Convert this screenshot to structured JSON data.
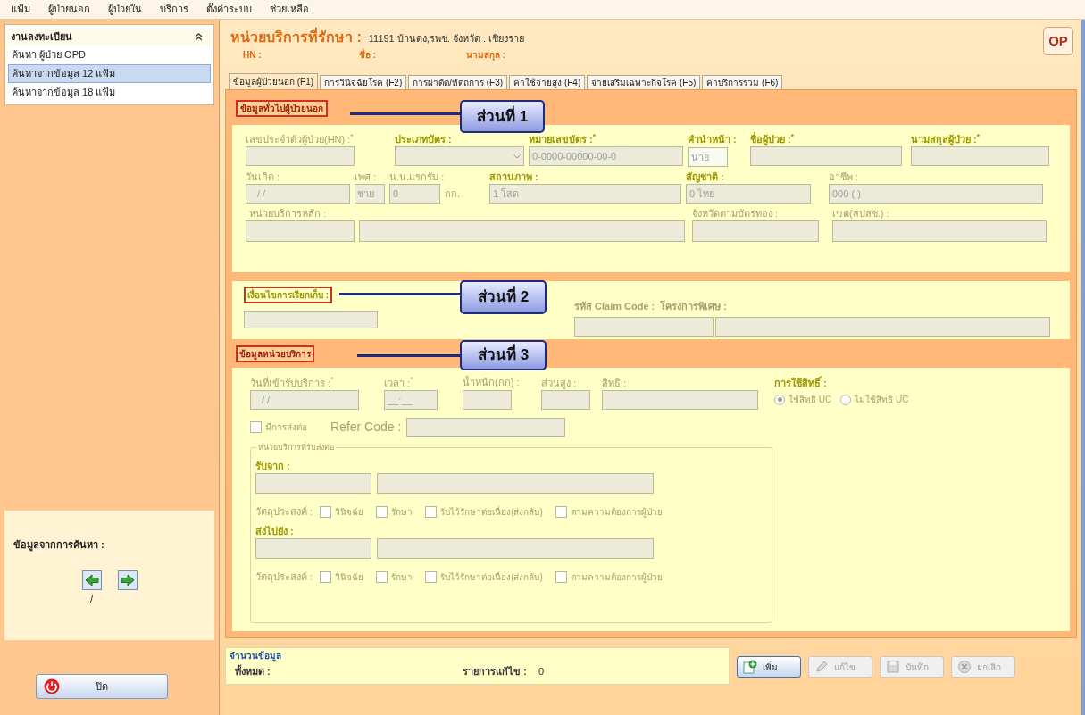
{
  "menu": [
    "แฟ้ม",
    "ผู้ป่วยนอก",
    "ผู้ป่วยใน",
    "บริการ",
    "ตั้งค่าระบบ",
    "ช่วยเหลือ"
  ],
  "sidebar": {
    "title": "งานลงทะเบียน",
    "items": [
      {
        "label": "ค้นหา ผู้ป่วย OPD",
        "selected": false
      },
      {
        "label": "ค้นหาจากข้อมูล 12 แฟ้ม",
        "selected": true
      },
      {
        "label": "ค้นหาจากข้อมูล 18 แฟ้ม",
        "selected": false
      }
    ],
    "search_result": {
      "label": "ข้อมูลจากการค้นหา :",
      "page": "/"
    },
    "close_button": "ปิด"
  },
  "header": {
    "title": "หน่วยบริการที่รักษา :",
    "unit": "11191 บ้านดง,รพช. จังหวัด : เชียงราย",
    "hn_label": "HN :",
    "name_label": "ชื่อ :",
    "surname_label": "นามสกุล :",
    "logo": "OP"
  },
  "tabs": [
    {
      "label": "ข้อมูลผู้ป่วยนอก (F1)",
      "selected": true
    },
    {
      "label": "การวินิจฉัยโรค (F2)",
      "selected": false
    },
    {
      "label": "การผ่าตัด/หัตถการ (F3)",
      "selected": false
    },
    {
      "label": "ค่าใช้จ่ายสูง (F4)",
      "selected": false
    },
    {
      "label": "จ่ายเสริมเฉพาะกิจโรค (F5)",
      "selected": false
    },
    {
      "label": "ค่าบริการรวม (F6)",
      "selected": false
    }
  ],
  "section_1": {
    "title": "ข้อมูลทั่วไปผู้ป่วยนอก",
    "callout": "ส่วนที่ 1",
    "fields": [
      {
        "label": "เลขประจำตัวผู้ป่วย(HN) :$^{*}$"
      },
      {
        "label": "ประเภทบัตร :"
      },
      {
        "label": "หมายเลขบัตร :$^{*}$",
        "value": "0-0000-00000-00-0"
      },
      {
        "label": "คำนำหน้า :",
        "value": "นาย"
      },
      {
        "label": "ชื่อผู้ป่วย :$^{*}$"
      },
      {
        "label": "นามสกุลผู้ป่วย :$^{*}$"
      },
      {
        "label": "วันเกิด :",
        "value": "/ /"
      },
      {
        "label": "เพศ :",
        "value": "ชาย"
      },
      {
        "label": "น.น.แรกรับ :",
        "value": "0",
        "unit": "กก."
      },
      {
        "label": "สถานภาพ :",
        "value": "1 โสด"
      },
      {
        "label": "สัญชาติ :",
        "value": "0 ไทย"
      },
      {
        "label": "อาชีพ :",
        "value": "000 ( )"
      },
      {
        "label": "หน่วยบริการหลัก :"
      },
      {
        "label": "จังหวัดตามบัตรทอง :"
      },
      {
        "label": "เขต(สปสช.) :"
      }
    ]
  },
  "section_2": {
    "title": "เงื่อนไขการเรียกเก็บ :",
    "callout": "ส่วนที่ 2",
    "claim_code_label": "รหัส Claim Code :",
    "project_label": "โครงการพิเศษ :"
  },
  "section_3": {
    "title": "ข้อมูลหน่วยบริการ",
    "callout": "ส่วนที่ 3",
    "fields": [
      {
        "label": "วันที่เข้ารับบริการ :$^{*}$",
        "value": "/ /"
      },
      {
        "label": "เวลา :$^{*}$",
        "value": "__:__"
      },
      {
        "label": "น้ำหนัก(กก) :"
      },
      {
        "label": "ส่วนสูง :"
      },
      {
        "label": "สิทธิ :"
      }
    ],
    "usage_label": "การใช้สิทธิ์ :",
    "usage_options": [
      {
        "label": "ใช้สิทธิ UC",
        "selected": true
      },
      {
        "label": "ไม่ใช้สิทธิ UC",
        "selected": false
      }
    ],
    "refer": {
      "label": "มีการส่งต่อ",
      "checked": false
    },
    "refer_code_label": "Refer Code :",
    "group_title": "หน่วยบริการที่รับส่งต่อ",
    "from_label": "รับจาก :",
    "to_label": "ส่งไปยัง :",
    "purpose_label_from": "วัตถุประสงค์ :",
    "purpose_from": [
      {
        "label": "วินิจฉัย",
        "checked": false
      },
      {
        "label": "รักษา",
        "checked": false
      },
      {
        "label": "รับไว้รักษาต่อเนื่อง(ส่งกลับ)",
        "checked": false
      },
      {
        "label": "ตามความต้องการผู้ป่วย",
        "checked": false
      }
    ],
    "purpose_label_to": "วัตถุประสงค์ :",
    "purpose_to": [
      {
        "label": "วินิจฉัย",
        "checked": false
      },
      {
        "label": "รักษา",
        "checked": false
      },
      {
        "label": "รับไว้รักษาต่อเนื่อง(ส่งกลับ)",
        "checked": false
      },
      {
        "label": "ตามความต้องการผู้ป่วย",
        "checked": false
      }
    ]
  },
  "summary": {
    "title": "จำนวนข้อมูล",
    "total_label": "ทั้งหมด :",
    "edited_label": "รายการแก้ไข :",
    "edited_count": "0"
  },
  "buttons": [
    {
      "kind": "add",
      "label": "เพิ่ม",
      "disabled": false
    },
    {
      "kind": "edit",
      "label": "แก้ไข",
      "disabled": true
    },
    {
      "kind": "save",
      "label": "บันทึก",
      "disabled": true
    },
    {
      "kind": "cancel",
      "label": "ยกเลิก",
      "disabled": true
    }
  ]
}
